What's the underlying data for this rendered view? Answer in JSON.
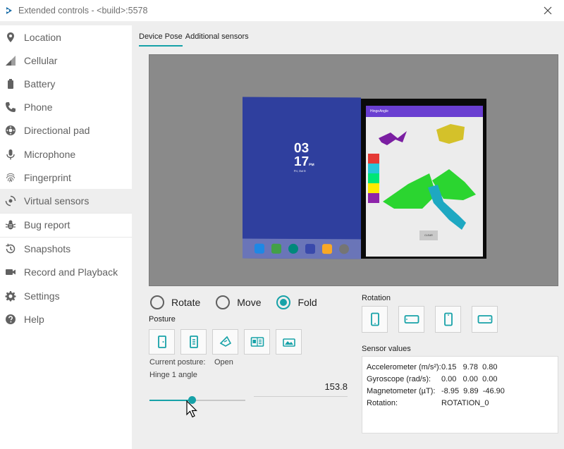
{
  "window": {
    "title": "Extended controls - <build>:5578",
    "close_icon": "close-icon"
  },
  "colors": {
    "accent": "#17a2a8",
    "sidebar_text": "#616161",
    "background": "#eeeeee"
  },
  "sidebar": {
    "items": [
      {
        "label": "Location",
        "icon": "location-pin-icon"
      },
      {
        "label": "Cellular",
        "icon": "cellular-signal-icon"
      },
      {
        "label": "Battery",
        "icon": "battery-icon"
      },
      {
        "label": "Phone",
        "icon": "phone-icon"
      },
      {
        "label": "Directional pad",
        "icon": "dpad-icon"
      },
      {
        "label": "Microphone",
        "icon": "microphone-icon"
      },
      {
        "label": "Fingerprint",
        "icon": "fingerprint-icon"
      },
      {
        "label": "Virtual sensors",
        "icon": "virtual-sensors-icon",
        "active": true
      },
      {
        "label": "Bug report",
        "icon": "bug-icon"
      },
      {
        "label": "Snapshots",
        "icon": "history-icon"
      },
      {
        "label": "Record and Playback",
        "icon": "video-camera-icon"
      },
      {
        "label": "Settings",
        "icon": "gear-icon"
      },
      {
        "label": "Help",
        "icon": "help-icon"
      }
    ]
  },
  "tabs": [
    {
      "label": "Device Pose",
      "active": true
    },
    {
      "label": "Additional sensors",
      "active": false
    }
  ],
  "preview": {
    "left_screen": {
      "time_hour": "03",
      "time_minute": "17",
      "time_suffix": "PM",
      "date": "Fri, Oct 9"
    },
    "right_screen": {
      "app_title": "HingeAngle",
      "clear_label": "CLEAR"
    }
  },
  "modes": [
    {
      "label": "Rotate",
      "checked": false
    },
    {
      "label": "Move",
      "checked": false
    },
    {
      "label": "Fold",
      "checked": true
    }
  ],
  "posture": {
    "label": "Posture",
    "buttons": [
      "posture-closed-icon",
      "posture-half-open-icon",
      "posture-tent-icon",
      "posture-open-book-icon",
      "posture-flipped-icon"
    ],
    "current_label": "Current posture:",
    "current_value": "Open",
    "hinge_label": "Hinge 1 angle",
    "hinge_value": "153.8",
    "hinge_fraction": 0.44
  },
  "rotation": {
    "label": "Rotation",
    "buttons": [
      "portrait-icon",
      "landscape-icon",
      "reverse-portrait-icon",
      "reverse-landscape-icon"
    ]
  },
  "sensors": {
    "label": "Sensor values",
    "rows": [
      {
        "name": "Accelerometer (m/s²):",
        "value": "0.15   9.78  0.80"
      },
      {
        "name": "Gyroscope (rad/s):",
        "value": "0.00   0.00  0.00"
      },
      {
        "name": "Magnetometer (µT):",
        "value": "-8.95  9.89  -46.90"
      },
      {
        "name": "Rotation:",
        "value": "ROTATION_0"
      }
    ]
  }
}
